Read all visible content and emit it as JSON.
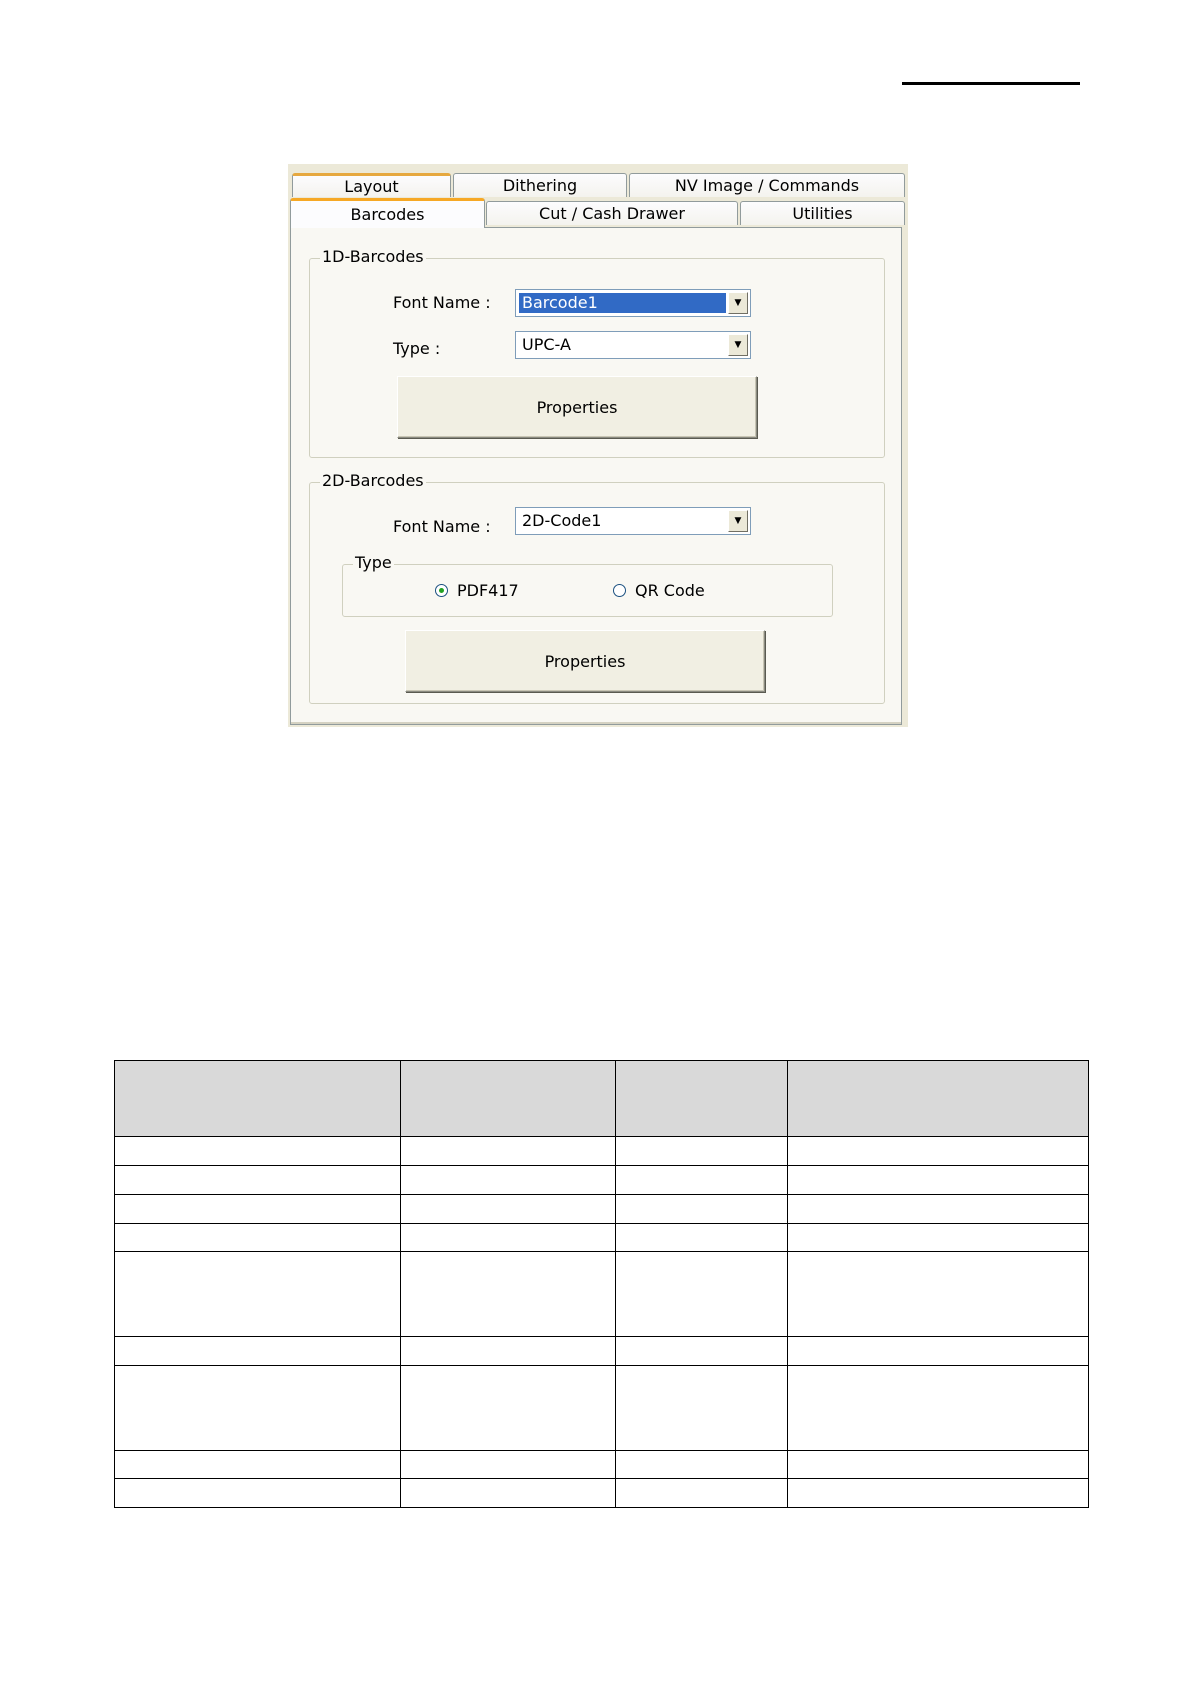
{
  "tabs": {
    "row1": [
      {
        "label": "Layout"
      },
      {
        "label": "Dithering"
      },
      {
        "label": "NV Image / Commands"
      }
    ],
    "row2": [
      {
        "label": "Barcodes"
      },
      {
        "label": "Cut / Cash Drawer"
      },
      {
        "label": "Utilities"
      }
    ]
  },
  "barcodes_1d": {
    "title": "1D-Barcodes",
    "font_name_label": "Font Name :",
    "font_name_value": "Barcode1",
    "type_label": "Type :",
    "type_value": "UPC-A",
    "properties_label": "Properties"
  },
  "barcodes_2d": {
    "title": "2D-Barcodes",
    "font_name_label": "Font Name :",
    "font_name_value": "2D-Code1",
    "type_group_title": "Type",
    "radio_pdf417": "PDF417",
    "radio_qr": "QR Code",
    "selected_type": "PDF417",
    "properties_label": "Properties"
  },
  "colors": {
    "selection": "#316ac5",
    "tab_highlight": "#f6a825",
    "dialog_bg": "#ece9d8"
  },
  "table": {
    "headers": [
      "",
      "",
      "",
      ""
    ],
    "row_count": 9
  }
}
